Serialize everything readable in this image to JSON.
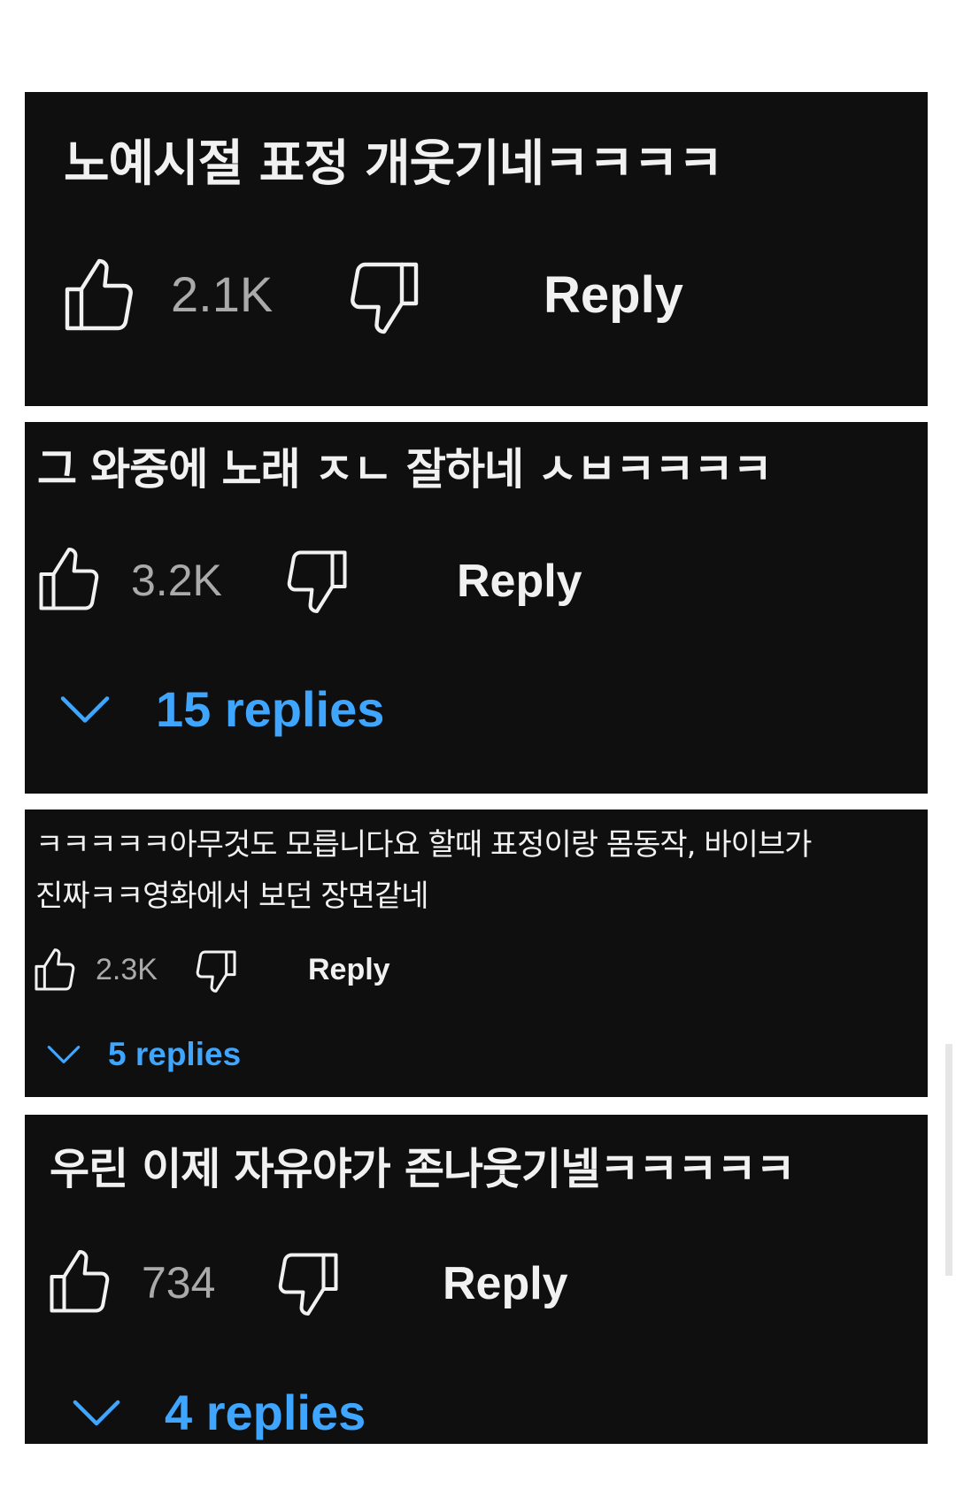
{
  "colors": {
    "card_background": "#0f0f0f",
    "text": "#f1f1f1",
    "like_count": "#aaaaaa",
    "replies_link": "#3ea6ff"
  },
  "icons": {
    "like": "thumbs-up-outline",
    "dislike": "thumbs-down-outline",
    "expand": "chevron-down"
  },
  "comments": [
    {
      "text": "노예시절 표정 개웃기네ㅋㅋㅋㅋ",
      "likes": "2.1K",
      "reply_label": "Reply"
    },
    {
      "text": "그 와중에 노래 ㅈㄴ 잘하네 ㅅㅂㅋㅋㅋㅋ",
      "likes": "3.2K",
      "reply_label": "Reply",
      "replies_label": "15 replies"
    },
    {
      "text_line1": "ㅋㅋㅋㅋㅋ아무것도 모릅니다요 할때 표정이랑 몸동작, 바이브가",
      "text_line2": "진짜ㅋㅋ영화에서 보던 장면같네",
      "likes": "2.3K",
      "reply_label": "Reply",
      "replies_label": "5 replies"
    },
    {
      "text": "우린 이제 자유야가 존나웃기넬ㅋㅋㅋㅋㅋ",
      "likes": "734",
      "reply_label": "Reply",
      "replies_label": "4 replies"
    }
  ]
}
